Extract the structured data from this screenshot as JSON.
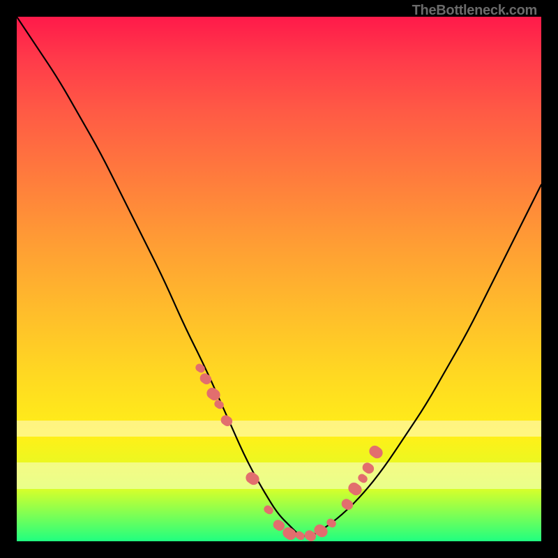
{
  "watermark": "TheBottleneck.com",
  "colors": {
    "frame": "#000000",
    "curve": "#000000",
    "dot": "#e26e6e",
    "gradient_stops": [
      "#ff1a4a",
      "#ff3a4a",
      "#ff5a45",
      "#ff7a3d",
      "#ff9a35",
      "#ffba2c",
      "#ffd822",
      "#fff018",
      "#d8ff2a",
      "#20ff80"
    ]
  },
  "chart_data": {
    "type": "line",
    "title": "",
    "xlabel": "",
    "ylabel": "",
    "xlim": [
      0,
      100
    ],
    "ylim": [
      0,
      100
    ],
    "grid": false,
    "legend": false,
    "x": [
      0,
      4,
      8,
      12,
      16,
      20,
      24,
      28,
      32,
      36,
      40,
      44,
      48,
      50,
      52,
      54,
      56,
      58,
      62,
      66,
      70,
      74,
      78,
      82,
      86,
      90,
      94,
      98,
      100
    ],
    "y": [
      100,
      94,
      88,
      81,
      74,
      66,
      58,
      50,
      41,
      33,
      24,
      15,
      8,
      5,
      3,
      1,
      1,
      2,
      5,
      9,
      14,
      20,
      26,
      33,
      40,
      48,
      56,
      64,
      68
    ],
    "highlight_points": {
      "x": [
        35,
        36,
        37.5,
        38.5,
        40,
        45,
        48,
        50,
        52,
        54,
        56,
        58,
        60,
        63,
        64.5,
        66,
        67,
        68.5
      ],
      "y": [
        33,
        31,
        28,
        26,
        23,
        12,
        6,
        3,
        1.5,
        1,
        1,
        2,
        3.5,
        7,
        10,
        12,
        14,
        17
      ]
    },
    "pale_bands_y": [
      {
        "from": 23,
        "to": 20
      },
      {
        "from": 15,
        "to": 10
      }
    ]
  }
}
